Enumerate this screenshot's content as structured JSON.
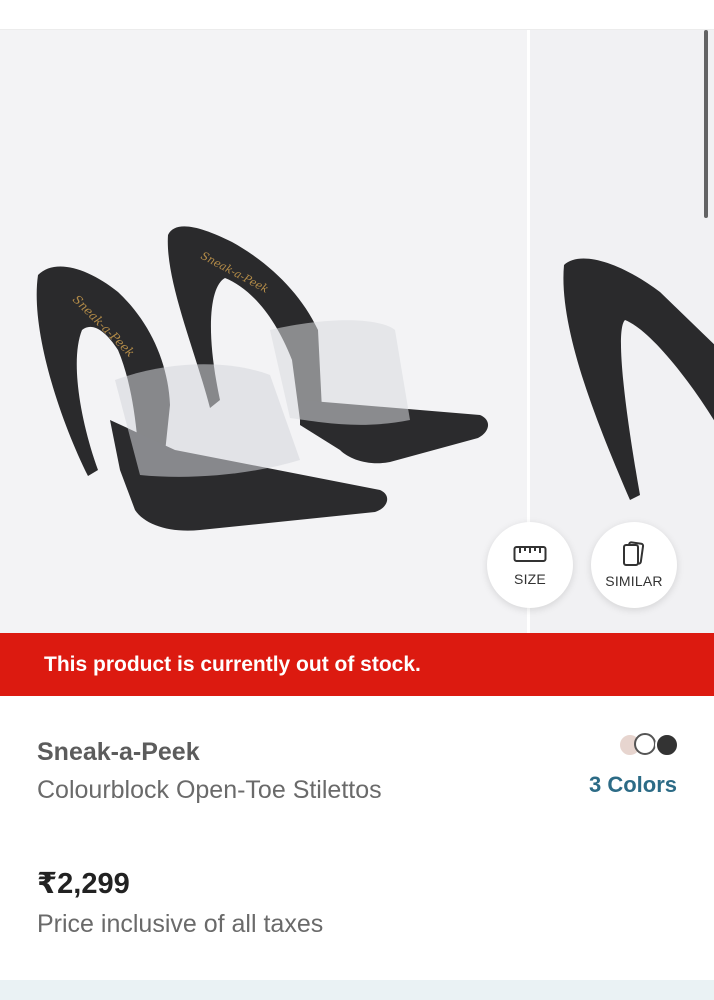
{
  "gallery": {
    "size_button_label": "SIZE",
    "similar_button_label": "SIMILAR"
  },
  "stock_banner": "This product is currently out of stock.",
  "product": {
    "brand": "Sneak-a-Peek",
    "name": "Colourblock Open-Toe Stilettos",
    "price": "₹2,299",
    "price_note": "Price inclusive of all taxes",
    "colors_label": "3 Colors",
    "swatch_colors": [
      "#e7d5cf",
      "#ffffff",
      "#333333"
    ],
    "insole_print": "Sneak-a-Peek"
  },
  "theme": {
    "banner_color": "#dc1a10",
    "link_color": "#2c6b86"
  },
  "icons": [
    "ruler-icon",
    "similar-cards-icon"
  ]
}
